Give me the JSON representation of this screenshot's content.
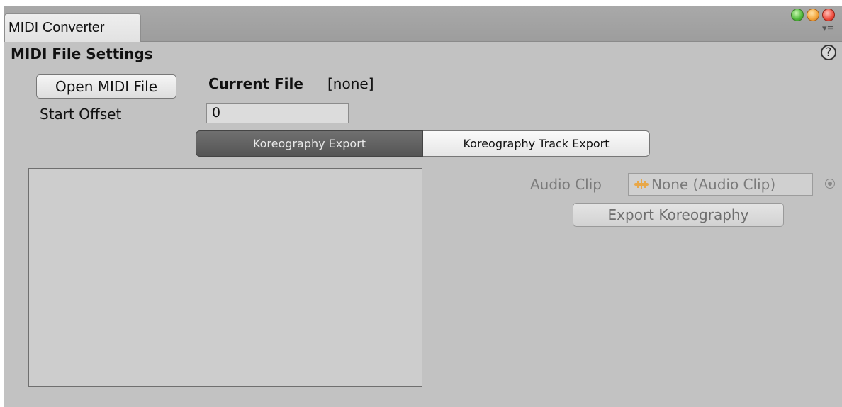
{
  "window": {
    "tab_title": "MIDI Converter"
  },
  "section": {
    "title": "MIDI File Settings"
  },
  "file": {
    "open_button_label": "Open MIDI File",
    "current_file_label": "Current File",
    "current_file_value": "[none]",
    "start_offset_label": "Start Offset",
    "start_offset_value": "0"
  },
  "export_tabs": [
    {
      "label": "Koreography Export",
      "active": true
    },
    {
      "label": "Koreography Track Export",
      "active": false
    }
  ],
  "audio": {
    "label": "Audio Clip",
    "field_value": "None (Audio Clip)",
    "export_button_label": "Export Koreography"
  },
  "colors": {
    "panel_background": "#c2c2c2",
    "tab_active": "#5f5f5f",
    "audio_icon": "#e8a84a"
  },
  "icons": {
    "help": "question-circle-icon",
    "menu": "menu-icon",
    "audio": "audio-clip-icon",
    "picker": "object-picker-icon"
  }
}
